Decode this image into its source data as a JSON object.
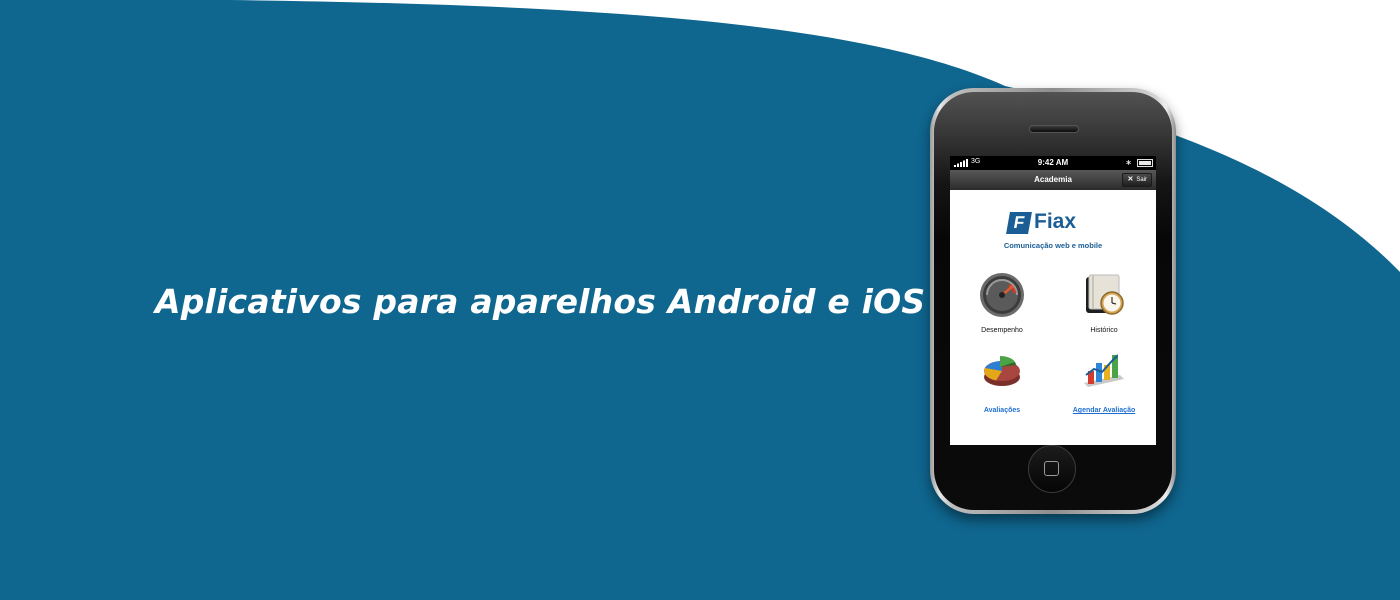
{
  "headline": "Aplicativos para aparelhos Android e iOS",
  "colors": {
    "background": "#0f668f",
    "curve": "#ffffff",
    "brand": "#1b5e95",
    "link": "#1f6fd3"
  },
  "phone": {
    "status_bar": {
      "network": "3G",
      "time": "9:42 AM",
      "bluetooth_icon": "bluetooth-icon",
      "battery_icon": "battery-icon"
    },
    "nav_bar": {
      "title": "Academia",
      "exit_icon": "close-icon",
      "exit_label": "Sair"
    },
    "logo": {
      "letter": "F",
      "name": "Fiax",
      "tagline": "Comunicação web e mobile"
    },
    "menu": [
      {
        "label": "Desempenho",
        "icon": "speedometer-icon"
      },
      {
        "label": "Histórico",
        "icon": "clock-history-icon"
      },
      {
        "label": "Avaliações",
        "icon": "pie-chart-icon"
      },
      {
        "label": "Agendar Avaliação",
        "icon": "bar-chart-icon"
      }
    ]
  }
}
